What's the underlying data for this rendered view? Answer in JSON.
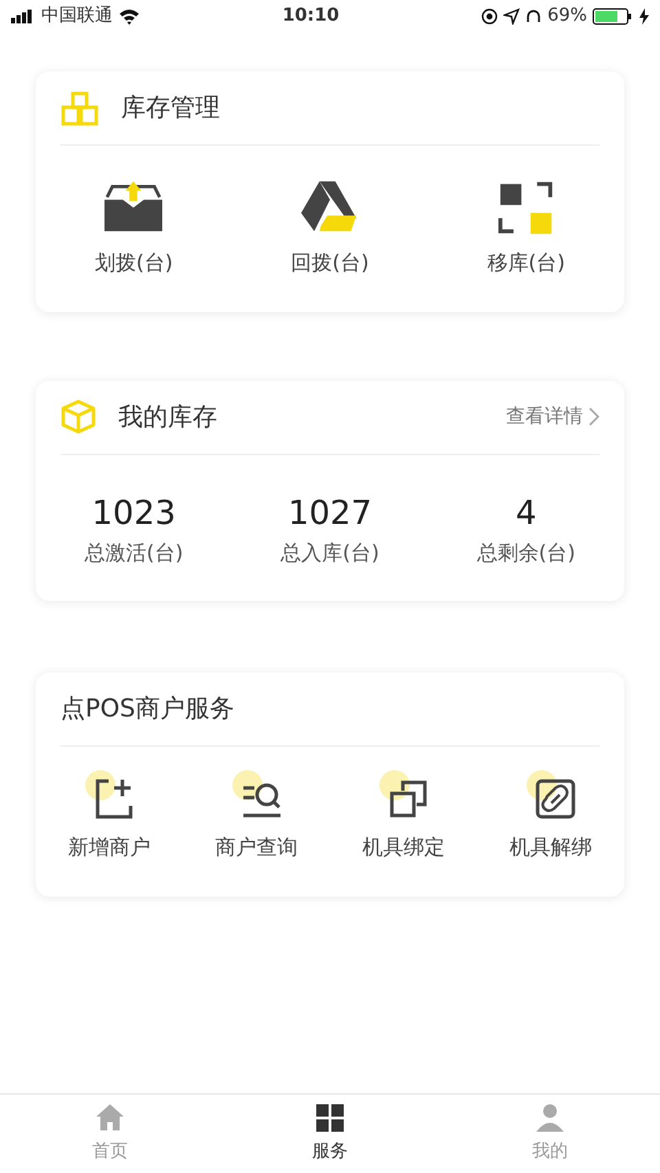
{
  "status_bar": {
    "carrier": "中国联通",
    "time": "10:10",
    "battery": "69%"
  },
  "inventory_management": {
    "title": "库存管理",
    "actions": [
      {
        "label": "划拨(台)"
      },
      {
        "label": "回拨(台)"
      },
      {
        "label": "移库(台)"
      }
    ]
  },
  "my_inventory": {
    "title": "我的库存",
    "link": "查看详情",
    "stats": [
      {
        "value": "1023",
        "label": "总激活(台)"
      },
      {
        "value": "1027",
        "label": "总入库(台)"
      },
      {
        "value": "4",
        "label": "总剩余(台)"
      }
    ]
  },
  "merchant_services": {
    "title": "点POS商户服务",
    "actions": [
      {
        "label": "新增商户"
      },
      {
        "label": "商户查询"
      },
      {
        "label": "机具绑定"
      },
      {
        "label": "机具解绑"
      }
    ]
  },
  "tab_bar": [
    {
      "label": "首页",
      "selected": false
    },
    {
      "label": "服务",
      "selected": true
    },
    {
      "label": "我的",
      "selected": false
    }
  ]
}
